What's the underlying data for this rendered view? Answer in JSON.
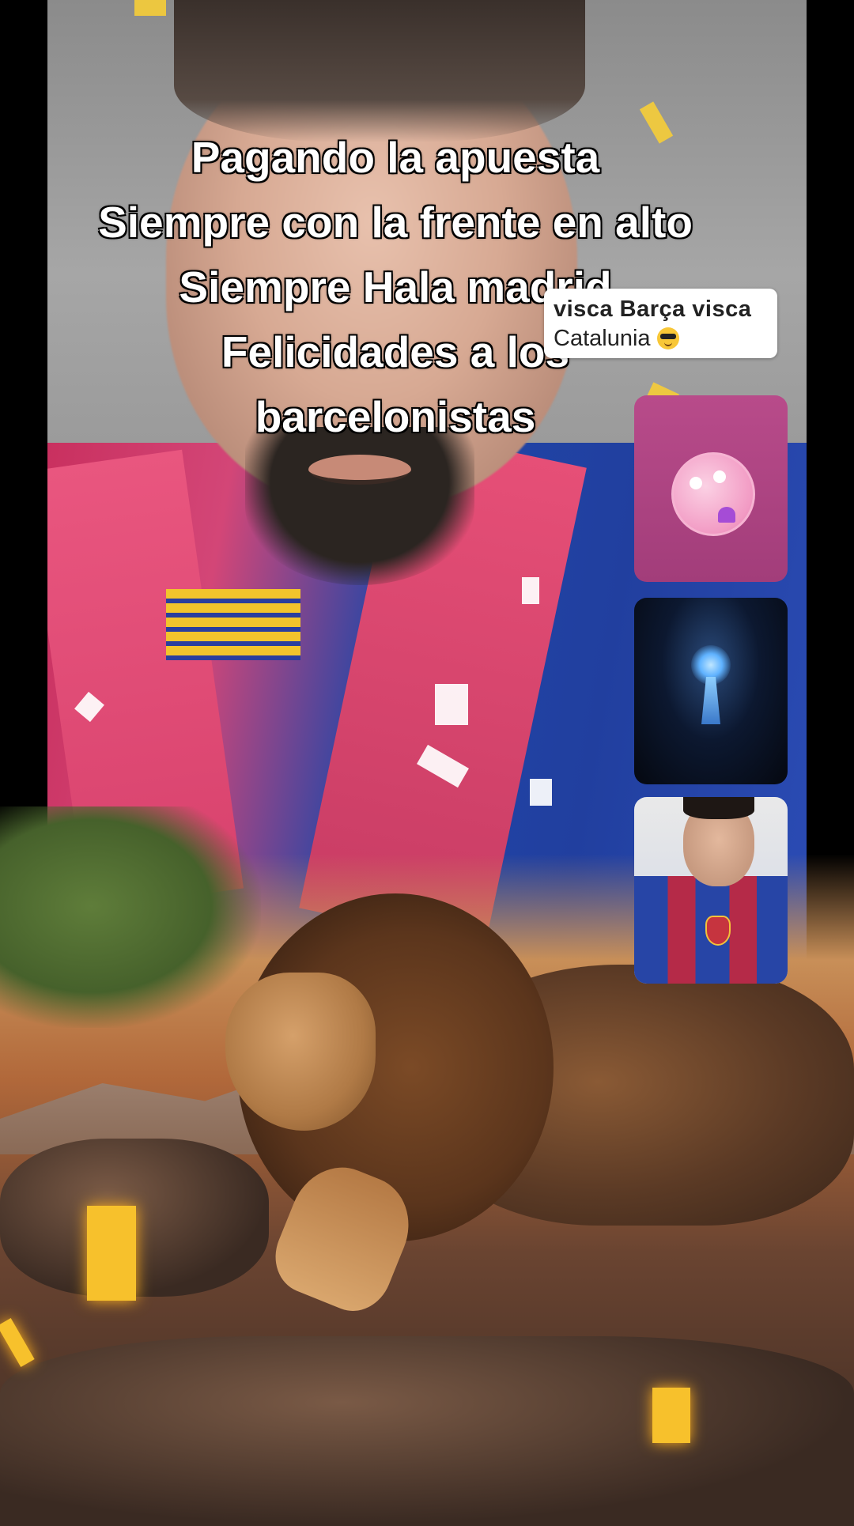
{
  "caption": {
    "line1": "Pagando la apuesta",
    "line2": "Siempre con la frente en alto",
    "line3": "Siempre Hala madrid",
    "line4": "Felicidades a los",
    "line5": "barcelonistas"
  },
  "comment": {
    "line1": "visca Barça visca",
    "line2": "Catalunia",
    "emoji": "sunglasses-emoji"
  },
  "guest_tiles": [
    {
      "icon": "pink-avatar"
    },
    {
      "icon": "glowing-keyhole-icon"
    },
    {
      "icon": "guest-video-person"
    }
  ],
  "colors": {
    "shirt_blue": "#2046a8",
    "scarf_pink": "#d8426d",
    "scarf_yellow": "#f1d13a",
    "tile_pink": "#b84b8a"
  }
}
